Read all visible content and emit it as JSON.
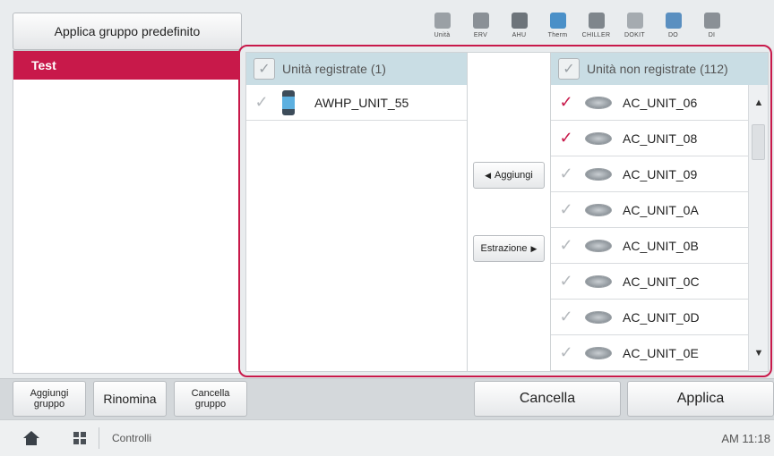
{
  "top": {
    "apply_default_label": "Applica gruppo predefinito",
    "device_toolbar": [
      {
        "label": "Unità",
        "icon": "indoor-unit-icon",
        "color": "#9aa0a5"
      },
      {
        "label": "ERV",
        "icon": "erv-icon",
        "color": "#8a9096"
      },
      {
        "label": "AHU",
        "icon": "ahu-icon",
        "color": "#6d747a"
      },
      {
        "label": "Therm",
        "icon": "thermostat-icon",
        "color": "#4a90c8"
      },
      {
        "label": "CHILLER",
        "icon": "chiller-icon",
        "color": "#7f868c"
      },
      {
        "label": "DOKIT",
        "icon": "dokit-icon",
        "color": "#a5abb0"
      },
      {
        "label": "DO",
        "icon": "do-icon",
        "color": "#5a8fc0"
      },
      {
        "label": "DI",
        "icon": "di-icon",
        "color": "#8a9096"
      }
    ]
  },
  "groups": [
    {
      "name": "Test",
      "selected": true
    }
  ],
  "registered": {
    "header": "Unità registrate (1)",
    "units": [
      {
        "name": "AWHP_UNIT_55",
        "checked": false,
        "icon": "awhp-unit-icon"
      }
    ]
  },
  "unregistered": {
    "header": "Unità non registrate (112)",
    "units": [
      {
        "name": "AC_UNIT_06",
        "checked": true,
        "icon": "ac-cassette-icon"
      },
      {
        "name": "AC_UNIT_08",
        "checked": true,
        "icon": "ac-cassette-icon"
      },
      {
        "name": "AC_UNIT_09",
        "checked": false,
        "icon": "ac-cassette-icon"
      },
      {
        "name": "AC_UNIT_0A",
        "checked": false,
        "icon": "ac-cassette-icon"
      },
      {
        "name": "AC_UNIT_0B",
        "checked": false,
        "icon": "ac-cassette-icon"
      },
      {
        "name": "AC_UNIT_0C",
        "checked": false,
        "icon": "ac-cassette-icon"
      },
      {
        "name": "AC_UNIT_0D",
        "checked": false,
        "icon": "ac-cassette-icon"
      },
      {
        "name": "AC_UNIT_0E",
        "checked": false,
        "icon": "ac-cassette-icon"
      }
    ]
  },
  "middle": {
    "add_label": "Aggiungi",
    "extract_label": "Estrazione"
  },
  "bottom": {
    "add_group_label": "Aggiungi gruppo",
    "rename_label": "Rinomina",
    "delete_group_label": "Cancella gruppo",
    "cancel_label": "Cancella",
    "apply_label": "Applica"
  },
  "status": {
    "breadcrumb": "Controlli",
    "time": "AM 11:18"
  },
  "colors": {
    "accent": "#c8194a",
    "header_bg": "#c9dde4"
  }
}
